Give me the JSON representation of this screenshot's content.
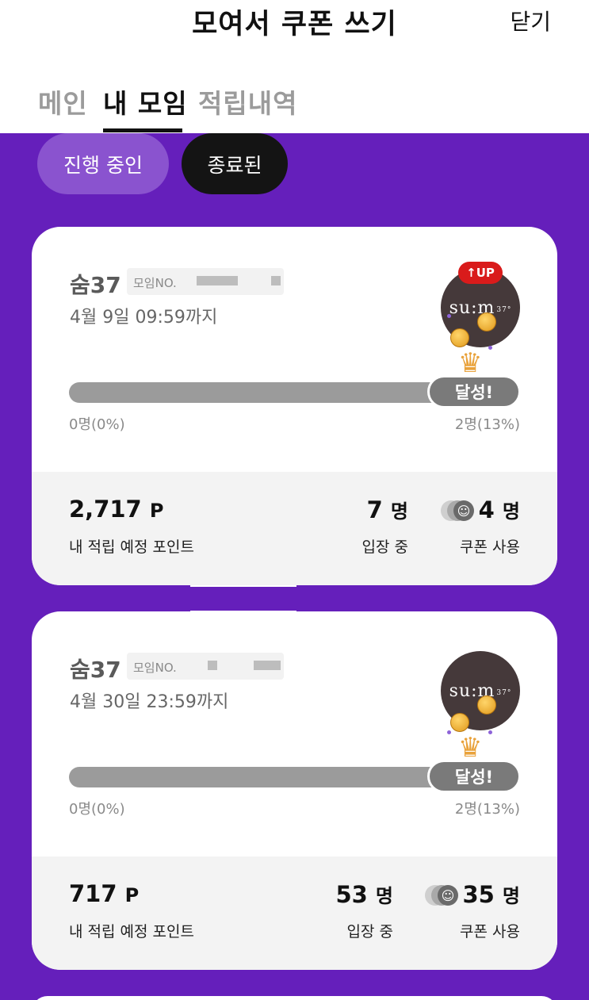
{
  "header": {
    "title": "모여서 쿠폰 쓰기",
    "close_label": "닫기"
  },
  "tabs": [
    {
      "label": "메인",
      "active": false
    },
    {
      "label": "내 모임",
      "active": true
    },
    {
      "label": "적립내역",
      "active": false
    }
  ],
  "filters": {
    "running_label": "진행 중인",
    "ended_label": "종료된",
    "selected": "종료된"
  },
  "cards": [
    {
      "brand": "숨37",
      "meeting_no_label": "모임NO.",
      "deadline": "4월 9일 09:59까지",
      "badge": "UP",
      "logo_text": "su:m",
      "logo_sub": "37°",
      "progress_label": "달성!",
      "range_start": "0명(0%)",
      "range_end": "2명(13%)",
      "points": "2,717",
      "points_unit": "P",
      "points_label": "내 적립 예정 포인트",
      "entered": "7",
      "entered_unit": "명",
      "entered_label": "입장 중",
      "coupons": "4",
      "coupons_unit": "명",
      "coupons_label": "쿠폰 사용"
    },
    {
      "brand": "숨37",
      "meeting_no_label": "모임NO.",
      "deadline": "4월 30일 23:59까지",
      "logo_text": "su:m",
      "logo_sub": "37°",
      "progress_label": "달성!",
      "range_start": "0명(0%)",
      "range_end": "2명(13%)",
      "points": "717",
      "points_unit": "P",
      "points_label": "내 적립 예정 포인트",
      "entered": "53",
      "entered_unit": "명",
      "entered_label": "입장 중",
      "coupons": "35",
      "coupons_unit": "명",
      "coupons_label": "쿠폰 사용"
    }
  ],
  "colors": {
    "purple": "#651fbb",
    "pill_running": "#8a53cf",
    "pill_ended": "#141414",
    "badge_red": "#d91b1b"
  },
  "icons": [
    "up-arrow-icon",
    "coin-icon",
    "crown-icon",
    "smile-stack-icon"
  ]
}
